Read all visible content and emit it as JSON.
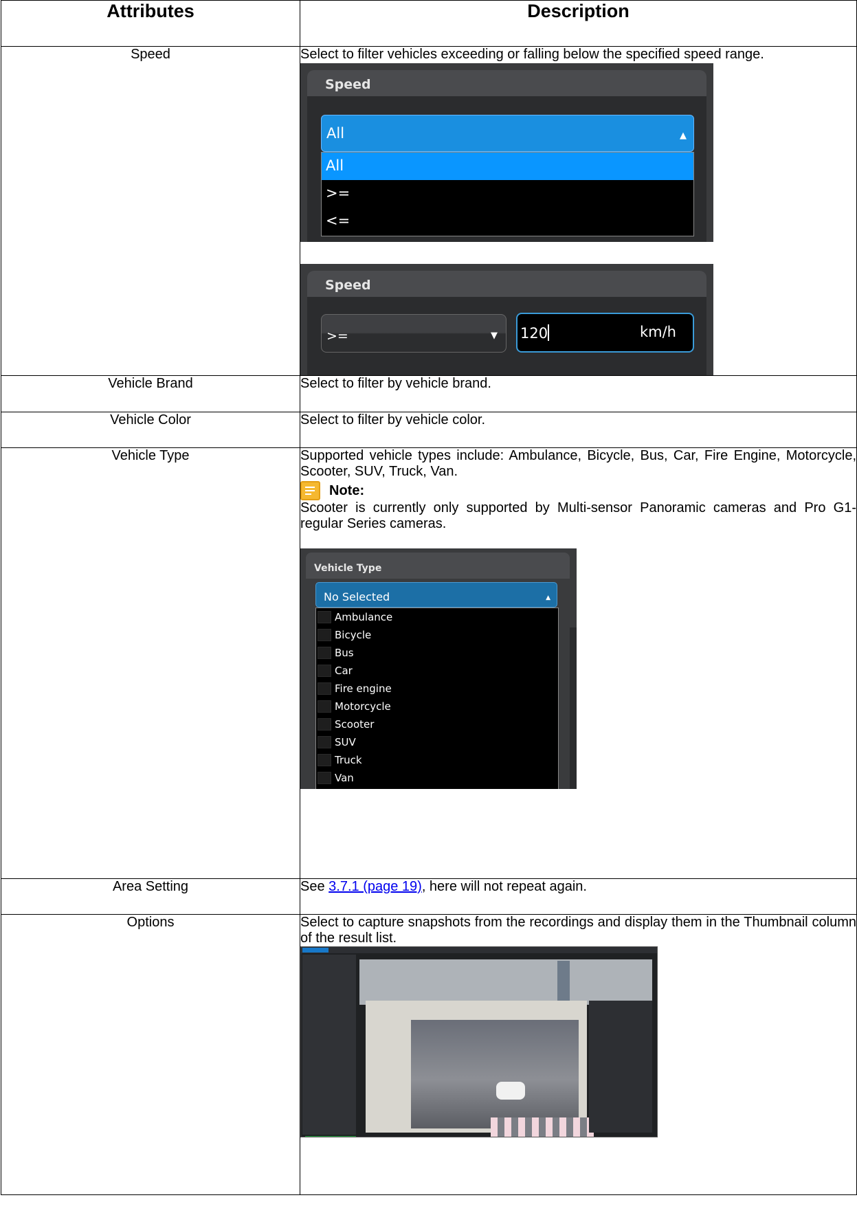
{
  "headers": {
    "attributes": "Attributes",
    "description": "Description"
  },
  "speed": {
    "name": "Speed",
    "text": "Select to filter vehicles exceeding or falling below the specified speed range.",
    "panel_title": "Speed",
    "selected": "All",
    "options": [
      "All",
      ">=",
      "<="
    ],
    "panel2_title": "Speed",
    "panel2_operator": ">=",
    "panel2_value": "120",
    "panel2_unit": "km/h"
  },
  "brand": {
    "name": "Vehicle Brand",
    "text": "Select to filter by vehicle brand."
  },
  "color": {
    "name": "Vehicle Color",
    "text": "Select to filter by vehicle color."
  },
  "vtype": {
    "name": "Vehicle Type",
    "text": "Supported vehicle types include: Ambulance, Bicycle, Bus, Car, Fire Engine, Motorcycle, Scooter, SUV, Truck, Van.",
    "note_label": "Note:",
    "note_text": "Scooter is currently only supported by Multi-sensor Panoramic cameras and Pro G1-regular Series cameras.",
    "panel_title": "Vehicle Type",
    "selected": "No Selected",
    "items": [
      "Ambulance",
      "Bicycle",
      "Bus",
      "Car",
      "Fire engine",
      "Motorcycle",
      "Scooter",
      "SUV",
      "Truck",
      "Van"
    ]
  },
  "area": {
    "name": "Area Setting",
    "text_before": "See ",
    "link": "3.7.1 (page 19)",
    "text_after": ", here will not repeat again."
  },
  "options": {
    "name": "Options",
    "text": "Select to capture snapshots from the recordings and display them in the Thumbnail column of the result list."
  }
}
